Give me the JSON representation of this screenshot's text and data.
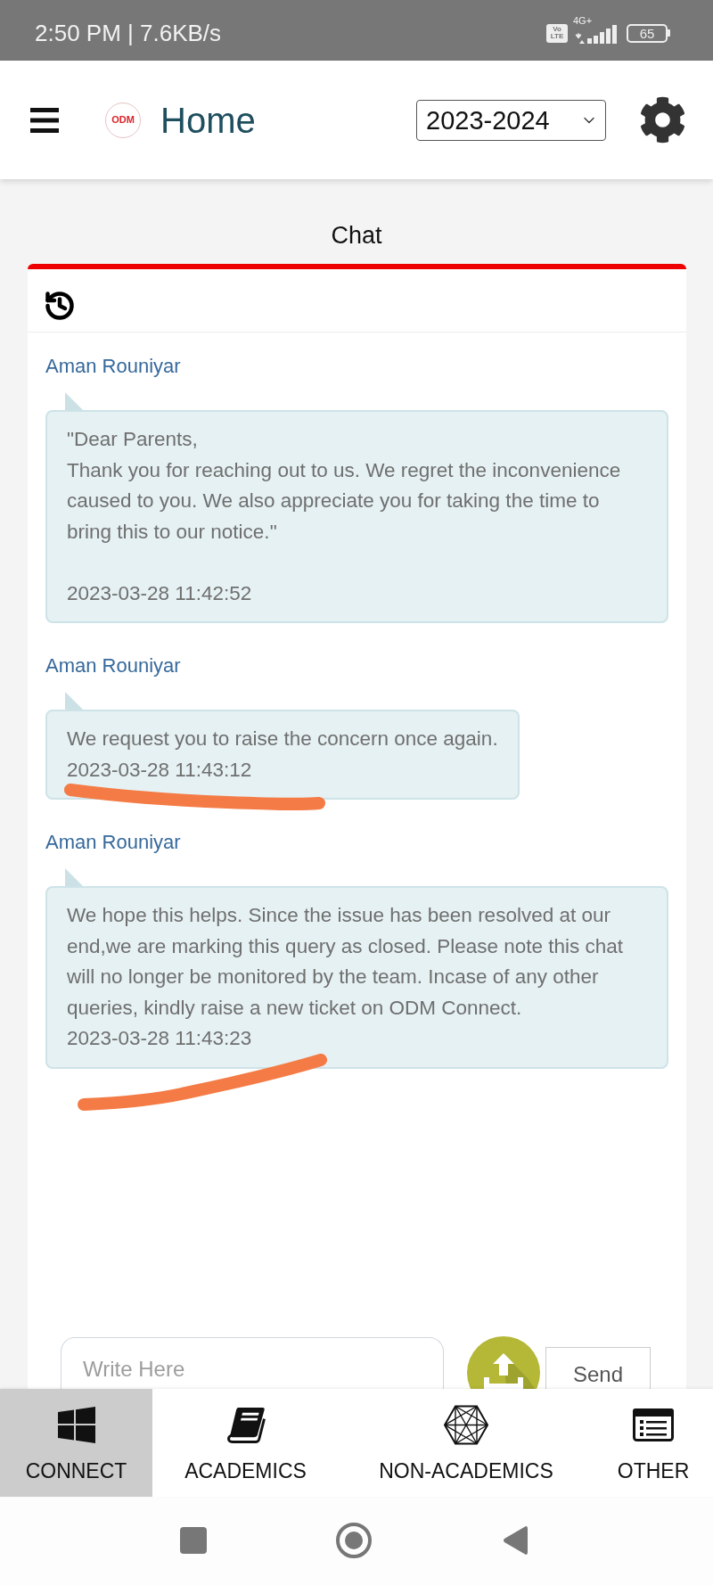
{
  "status_bar": {
    "time": "2:50 PM | 7.6KB/s",
    "volte": [
      "Vo",
      "LTE"
    ],
    "network": "4G+",
    "battery": "65"
  },
  "header": {
    "logo": "ODM",
    "title": "Home",
    "year": "2023-2024"
  },
  "chat": {
    "title": "Chat",
    "messages": [
      {
        "kind": "plain",
        "sender": "Aman Rouniyar",
        "text": "\"Dear Parents,\nThank you for reaching out to us. We regret the inconvenience caused to you. We also appreciate you for taking the time to bring this to our notice.\"\n\n",
        "time": "2023-03-28 11:42:52"
      },
      {
        "kind": "underlined",
        "sender": "Aman Rouniyar",
        "text": "We request you to raise the concern once again.",
        "time": "2023-03-28 11:43:12"
      },
      {
        "kind": "slant_underlined",
        "sender": "Aman Rouniyar",
        "text": "We hope this helps. Since the issue has been resolved at our end,we are marking this query as closed. Please note this chat will no longer be monitored by the team. Incase of any other queries, kindly raise a new ticket on ODM Connect.",
        "time": "2023-03-28 11:43:23"
      }
    ]
  },
  "composer": {
    "placeholder": "Write Here",
    "send": "Send"
  },
  "bottom_nav": [
    {
      "kind": "windows",
      "label": "CONNECT",
      "selected": true
    },
    {
      "kind": "book",
      "label": "ACADEMICS",
      "selected": false
    },
    {
      "kind": "hexagon",
      "label": "NON-ACADEMICS",
      "selected": false
    },
    {
      "kind": "list",
      "label": "OTHER",
      "selected": false
    }
  ]
}
